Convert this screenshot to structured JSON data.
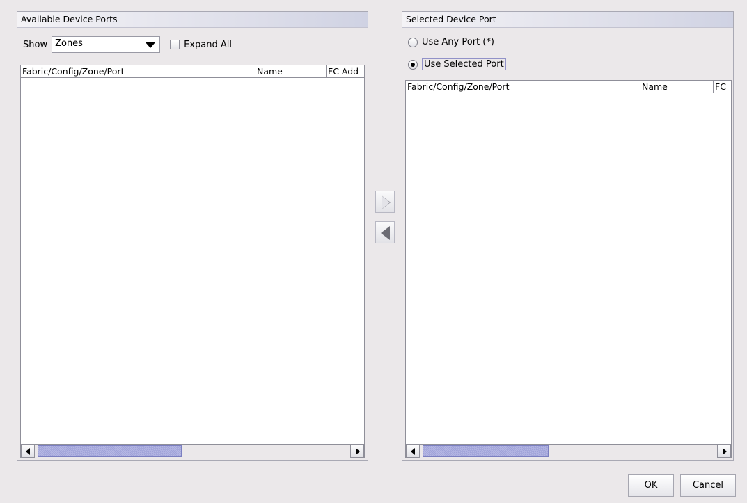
{
  "available": {
    "title": "Available Device Ports",
    "show_label": "Show",
    "show_value": "Zones",
    "expand_all_label": "Expand All",
    "expand_all_checked": false,
    "columns": [
      "Fabric/Config/Zone/Port",
      "Name",
      "FC Add"
    ],
    "rows": []
  },
  "move": {
    "add_icon": "triangle-right-icon",
    "remove_icon": "triangle-left-icon"
  },
  "selected": {
    "title": "Selected Device Port",
    "radio_any_label": "Use Any Port (*)",
    "radio_selected_label": "Use Selected Port",
    "selected_option": "Use Selected Port",
    "columns": [
      "Fabric/Config/Zone/Port",
      "Name",
      "FC"
    ],
    "rows": []
  },
  "buttons": {
    "ok": "OK",
    "cancel": "Cancel"
  },
  "colors": {
    "background": "#ebe8ea",
    "scroll_thumb": "#9fa2d8",
    "header_gradient_end": "#cfd2e3"
  }
}
